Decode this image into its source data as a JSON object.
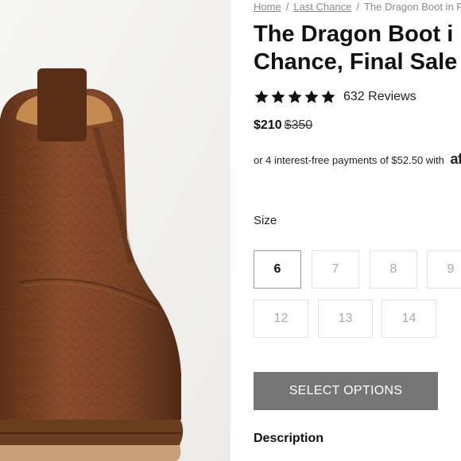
{
  "breadcrumb": {
    "items": [
      "Home",
      "Last Chance",
      "The Dragon Boot in Re"
    ],
    "separator": "/"
  },
  "product": {
    "title_line1": "The Dragon Boot i",
    "title_line2": "Chance, Final Sale",
    "rating": 5,
    "review_count": "632 Reviews",
    "sale_price": "$210",
    "original_price": "$350",
    "installments_text": "or 4 interest-free payments of $52.50 with",
    "installments_brand": "af",
    "image_alt": "boot-photo"
  },
  "size": {
    "label": "Size",
    "options": [
      "6",
      "7",
      "8",
      "9",
      "12",
      "13",
      "14"
    ],
    "selected": "6"
  },
  "cta": {
    "label": "SELECT OPTIONS"
  },
  "description": {
    "heading": "Description"
  },
  "colors": {
    "cta_bg": "#757575",
    "star": "#111111",
    "leather": "#7a4528"
  }
}
